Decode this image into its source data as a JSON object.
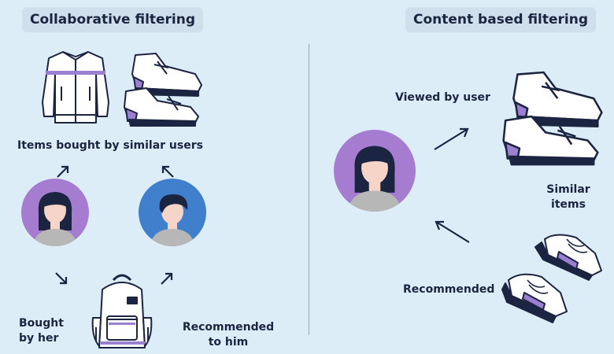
{
  "left": {
    "heading": "Collaborative filtering",
    "items_label": "Items bought by similar users",
    "bought_label_line1": "Bought",
    "bought_label_line2": "by her",
    "recommended_label_line1": "Recommended",
    "recommended_label_line2": "to him"
  },
  "right": {
    "heading": "Content based filtering",
    "viewed_label": "Viewed by user",
    "similar_label_line1": "Similar",
    "similar_label_line2": "items",
    "recommended_label": "Recommended"
  },
  "colors": {
    "background": "#dcedf8",
    "heading_bg": "#cfe0ec",
    "text": "#1b2440",
    "purple_avatar": "#a57ccf",
    "blue_avatar": "#3f7fcc",
    "accent_purple": "#9b7fd1",
    "navy": "#1b2440"
  }
}
